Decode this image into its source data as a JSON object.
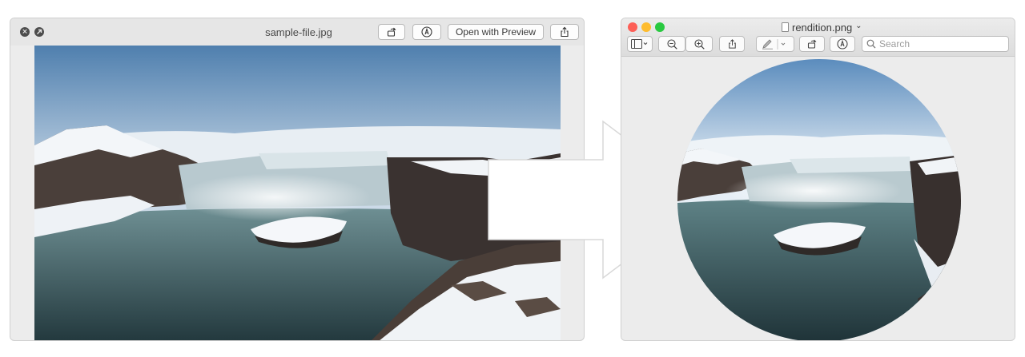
{
  "quicklook": {
    "title": "sample-file.jpg",
    "open_with_label": "Open with Preview",
    "icons": [
      "close-icon",
      "fullscreen-icon",
      "rotate-icon",
      "markup-icon",
      "share-icon"
    ]
  },
  "preview": {
    "title": "rendition.png",
    "title_chevron": "⌄",
    "search_placeholder": "Search",
    "icons": [
      "sidebar-icon",
      "zoom-out-icon",
      "zoom-in-icon",
      "share-icon",
      "pen-icon",
      "rotate-icon",
      "markup-icon",
      "search-icon"
    ],
    "traffic_colors": [
      "#fd5f57",
      "#febc2e",
      "#29c940"
    ]
  },
  "arrow": {
    "color": "#ffffff",
    "outline": "#d8d8d8"
  },
  "image_palette": {
    "sky": "#c9d8e6",
    "snow": "#f2f5f8",
    "rock": "#3e3a38",
    "water": "#3d5a5e"
  }
}
